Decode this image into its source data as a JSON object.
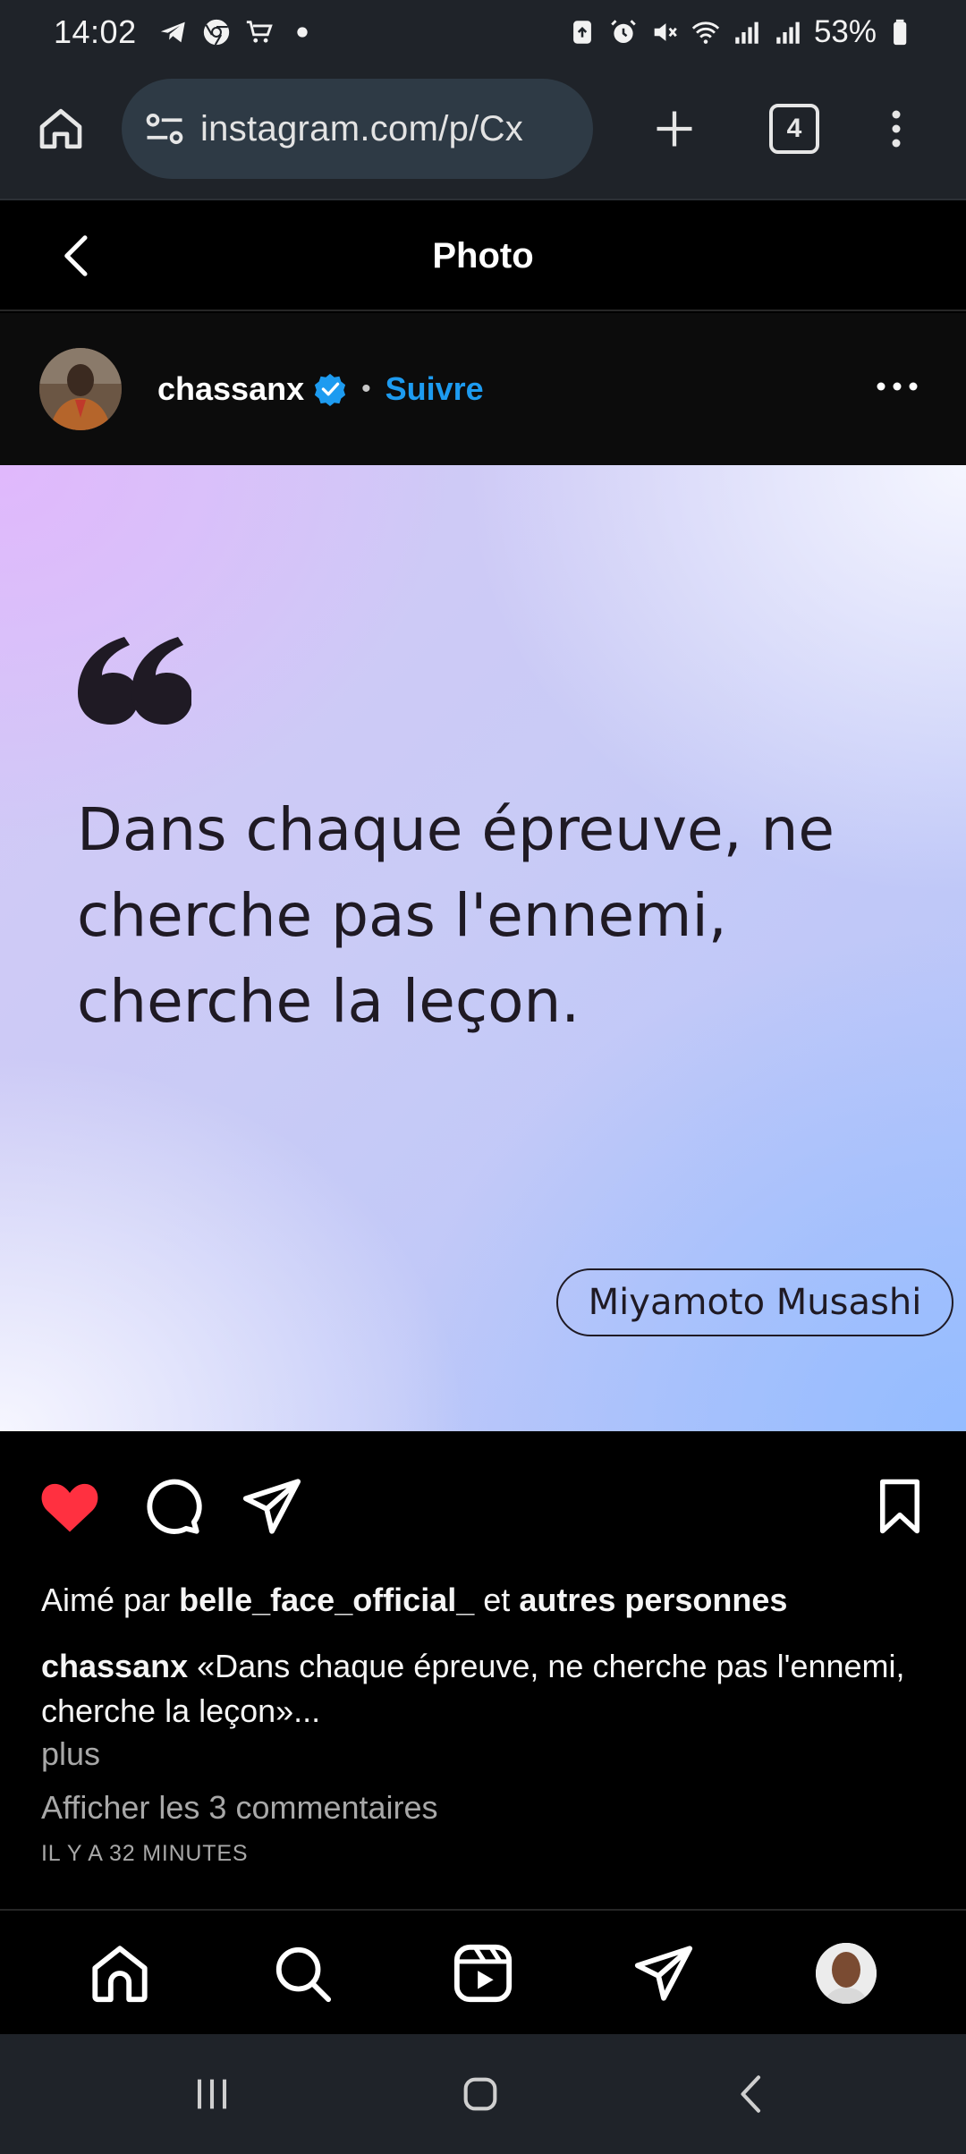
{
  "status_bar": {
    "time": "14:02",
    "battery_percent": "53%",
    "icons": [
      "telegram-icon",
      "chrome-icon",
      "shopping-cart-icon",
      "dot-icon",
      "recycle-icon",
      "alarm-icon",
      "mute-icon",
      "wifi-icon",
      "signal-icon",
      "signal-icon",
      "battery-icon"
    ]
  },
  "browser": {
    "url": "instagram.com/p/Cx",
    "tab_count": "4"
  },
  "ig_header": {
    "title": "Photo"
  },
  "post": {
    "username": "chassanx",
    "separator": "•",
    "follow_label": "Suivre",
    "image": {
      "quote": "Dans chaque épreuve, ne cherche pas l'ennemi, cherche la leçon.",
      "author": "Miyamoto Musashi"
    },
    "liked": true,
    "likes_prefix": "Aimé par",
    "likes_user": "belle_face_official_",
    "likes_and": "et",
    "likes_others": "autres personnes",
    "caption_user": "chassanx",
    "caption_text": "«Dans chaque épreuve, ne cherche pas l'ennemi, cherche la leçon»...",
    "more_label": "plus",
    "comments_label": "Afficher les 3 commentaires",
    "time_ago": "IL Y A 32 MINUTES"
  },
  "colors": {
    "accent_blue": "#1d9bf0",
    "like_red": "#ff3040",
    "chrome_bar": "#1f2329"
  }
}
